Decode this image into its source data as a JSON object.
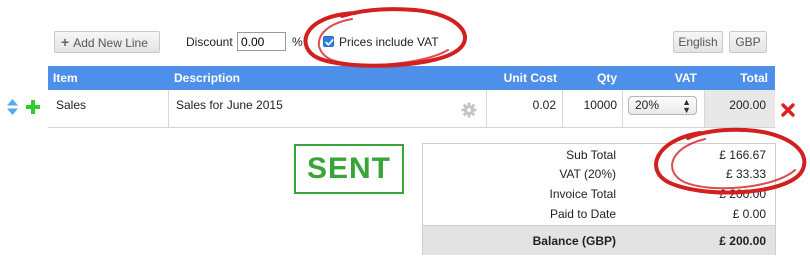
{
  "toolbar": {
    "add_line_label": "Add New Line",
    "discount_label": "Discount",
    "discount_value": "0.00",
    "percent_symbol": "%",
    "prices_include_vat_label": "Prices include VAT",
    "prices_include_vat_checked": true,
    "language_label": "English",
    "currency_label": "GBP"
  },
  "table": {
    "headers": [
      "Item",
      "Description",
      "Unit Cost",
      "Qty",
      "VAT",
      "Total"
    ],
    "rows": [
      {
        "item": "Sales",
        "description": "Sales for June 2015",
        "unit_cost": "0.02",
        "qty": "10000",
        "vat": "20%",
        "total": "200.00"
      }
    ]
  },
  "status_stamp": "SENT",
  "totals": {
    "sub_total_label": "Sub Total",
    "sub_total_value": "£ 166.67",
    "vat_label": "VAT (20%)",
    "vat_value": "£ 33.33",
    "invoice_total_label": "Invoice Total",
    "invoice_total_value": "£ 200.00",
    "paid_label": "Paid to Date",
    "paid_value": "£ 0.00",
    "balance_label": "Balance (GBP)",
    "balance_value": "£ 200.00"
  },
  "colors": {
    "header_bg": "#4d8fe9",
    "sent_green": "#3aa33a",
    "delete_red": "#e02020",
    "add_green": "#2ecc2e",
    "annotation_red": "#d21f1f"
  }
}
